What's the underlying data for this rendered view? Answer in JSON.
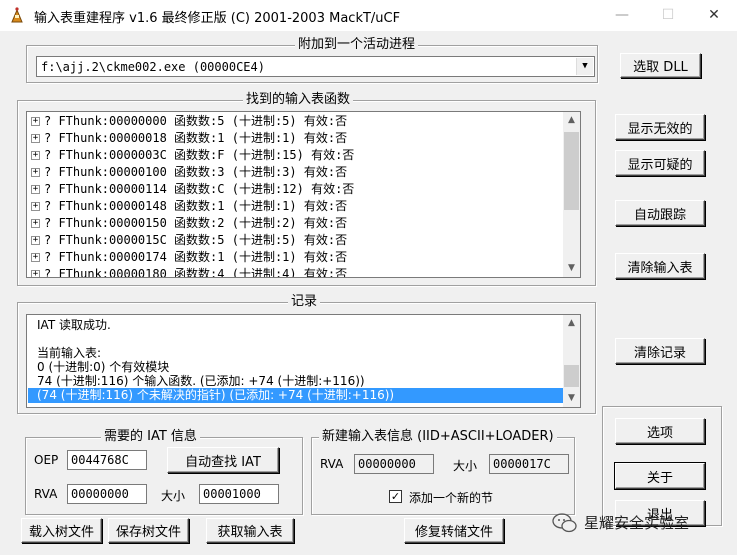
{
  "window": {
    "title": "输入表重建程序 v1.6 最终修正版 (C) 2001-2003 MackT/uCF",
    "min_glyph": "—",
    "max_glyph": "☐",
    "close_glyph": "✕"
  },
  "attach": {
    "group_title": "附加到一个活动进程",
    "process_value": "f:\\ajj.2\\ckme002.exe (00000CE4)",
    "pick_dll_label": "选取 DLL"
  },
  "imports": {
    "group_title": "找到的输入表函数",
    "rows": [
      "? FThunk:00000000 函数数:5 (十进制:5) 有效:否",
      "? FThunk:00000018 函数数:1 (十进制:1) 有效:否",
      "? FThunk:0000003C 函数数:F (十进制:15) 有效:否",
      "? FThunk:00000100 函数数:3 (十进制:3) 有效:否",
      "? FThunk:00000114 函数数:C (十进制:12) 有效:否",
      "? FThunk:00000148 函数数:1 (十进制:1) 有效:否",
      "? FThunk:00000150 函数数:2 (十进制:2) 有效:否",
      "? FThunk:0000015C 函数数:5 (十进制:5) 有效:否",
      "? FThunk:00000174 函数数:1 (十进制:1) 有效:否",
      "? FThunk:00000180 函数数:4 (十进制:4) 有效:否"
    ]
  },
  "side_buttons": {
    "show_invalid": "显示无效的",
    "show_suspect": "显示可疑的",
    "auto_trace": "自动跟踪",
    "clear_imports": "清除输入表",
    "clear_log": "清除记录",
    "options": "选项",
    "about": "关于",
    "exit": "退出"
  },
  "log": {
    "group_title": "记录",
    "lines": [
      "IAT 读取成功.",
      "",
      "当前输入表:",
      "0 (十进制:0) 个有效模块",
      "74 (十进制:116) 个输入函数. (已添加: +74 (十进制:+116))",
      "(74 (十进制:116) 个未解决的指针) (已添加: +74 (十进制:+116))"
    ]
  },
  "iat": {
    "group_title": "需要的 IAT 信息",
    "oep_label": "OEP",
    "oep_value": "0044768C",
    "auto_search_label": "自动查找 IAT",
    "rva_label": "RVA",
    "rva_value": "00000000",
    "size_label": "大小",
    "size_value": "00001000"
  },
  "new_import": {
    "group_title": "新建输入表信息 (IID+ASCII+LOADER)",
    "rva_label": "RVA",
    "rva_value": "00000000",
    "size_label": "大小",
    "size_value": "0000017C",
    "add_section_label": "添加一个新的节",
    "add_section_checked": true,
    "check_glyph": "✓"
  },
  "bottom_buttons": {
    "load_tree": "载入树文件",
    "save_tree": "保存树文件",
    "get_imports": "获取输入表",
    "fix_dump": "修复转储文件"
  },
  "watermark": {
    "text": "星耀安全实验室"
  },
  "colors": {
    "selection": "#3399ff",
    "face": "#f0f0f0"
  }
}
